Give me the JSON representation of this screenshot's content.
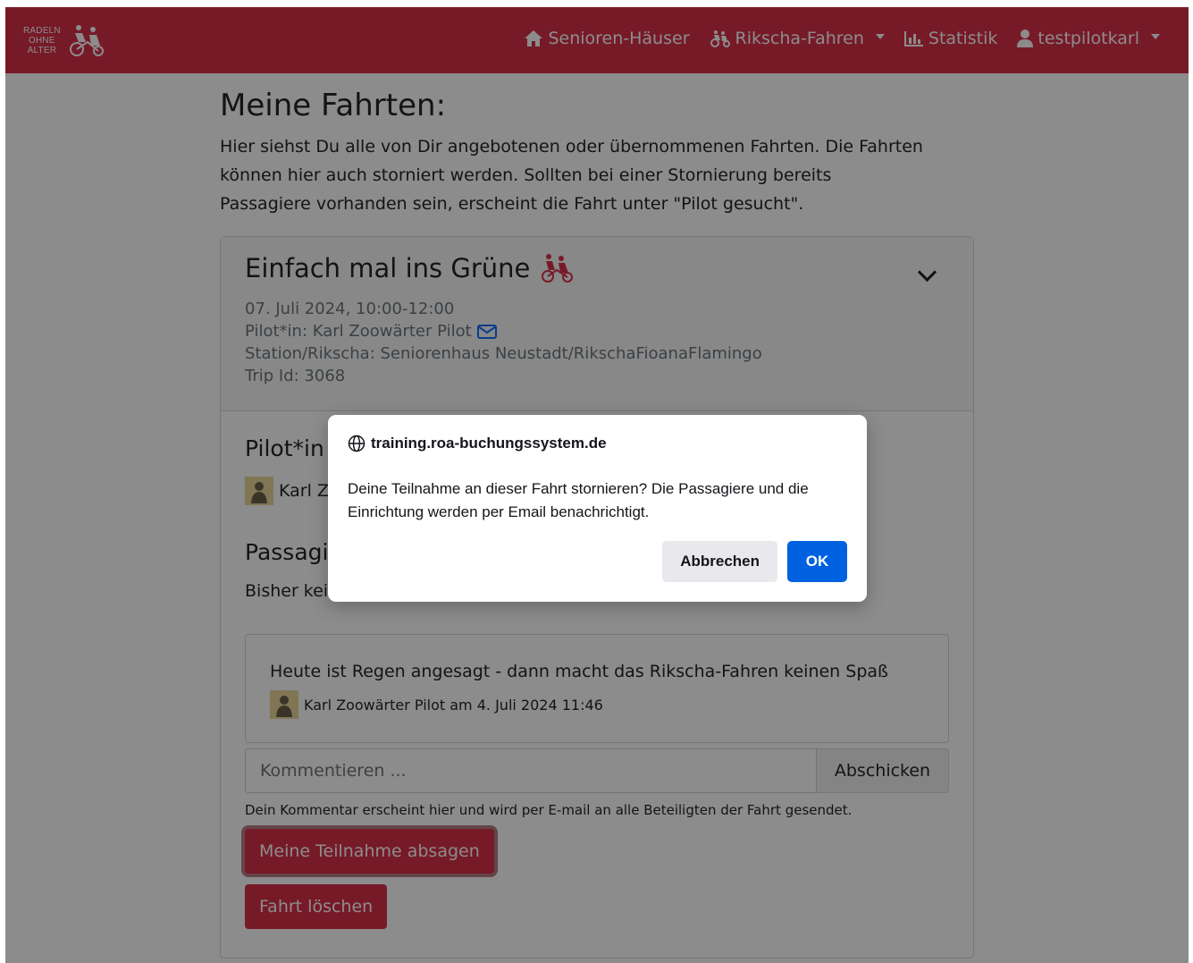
{
  "brand": {
    "line1": "RADELN",
    "line2": "OHNE",
    "line3": "ALTER"
  },
  "nav": {
    "items": [
      {
        "label": "Senioren-Häuser",
        "icon": "home-icon"
      },
      {
        "label": "Rikscha-Fahren",
        "icon": "rickshaw-icon",
        "dropdown": true
      },
      {
        "label": "Statistik",
        "icon": "bar-chart-icon"
      },
      {
        "label": "testpilotkarl",
        "icon": "user-icon",
        "dropdown": true
      }
    ]
  },
  "page": {
    "title": "Meine Fahrten:",
    "intro": "Hier siehst Du alle von Dir angebotenen oder übernommenen Fahrten. Die Fahrten können hier auch storniert werden. Sollten bei einer Stornierung bereits Passagiere vorhanden sein, erscheint die Fahrt unter \"Pilot gesucht\"."
  },
  "trip": {
    "title": "Einfach mal ins Grüne",
    "date": "07. Juli 2024, 10:00-12:00",
    "pilot": "Pilot*in: Karl Zoowärter Pilot",
    "station": "Station/Rikscha: Seniorenhaus Neustadt/RikschaFioanaFlamingo",
    "trip_id": "Trip Id: 3068",
    "pilot_section_title": "Pilot*in",
    "pilot_name": "Karl Z",
    "passengers_title": "Passagi",
    "no_passengers": "Bisher kei",
    "comment": {
      "text": "Heute ist Regen angesagt - dann macht das Rikscha-Fahren keinen Spaß",
      "author_line": "Karl Zoowärter Pilot am 4. Juli 2024 11:46"
    },
    "comment_placeholder": "Kommentieren ...",
    "send_label": "Abschicken",
    "hint": "Dein Kommentar erscheint hier und wird per E-mail an alle Beteiligten der Fahrt gesendet.",
    "cancel_participation_label": "Meine Teilnahme absagen",
    "delete_trip_label": "Fahrt löschen"
  },
  "dialog": {
    "host": "training.roa-buchungssystem.de",
    "message": "Deine Teilnahme an dieser Fahrt stornieren? Die Passagiere und die Einrichtung werden per Email benachrichtigt.",
    "cancel_label": "Abbrechen",
    "ok_label": "OK"
  },
  "colors": {
    "brand": "#d9304a",
    "dialog_primary": "#0061e0",
    "overlay": "rgba(0,0,0,0.45)"
  }
}
